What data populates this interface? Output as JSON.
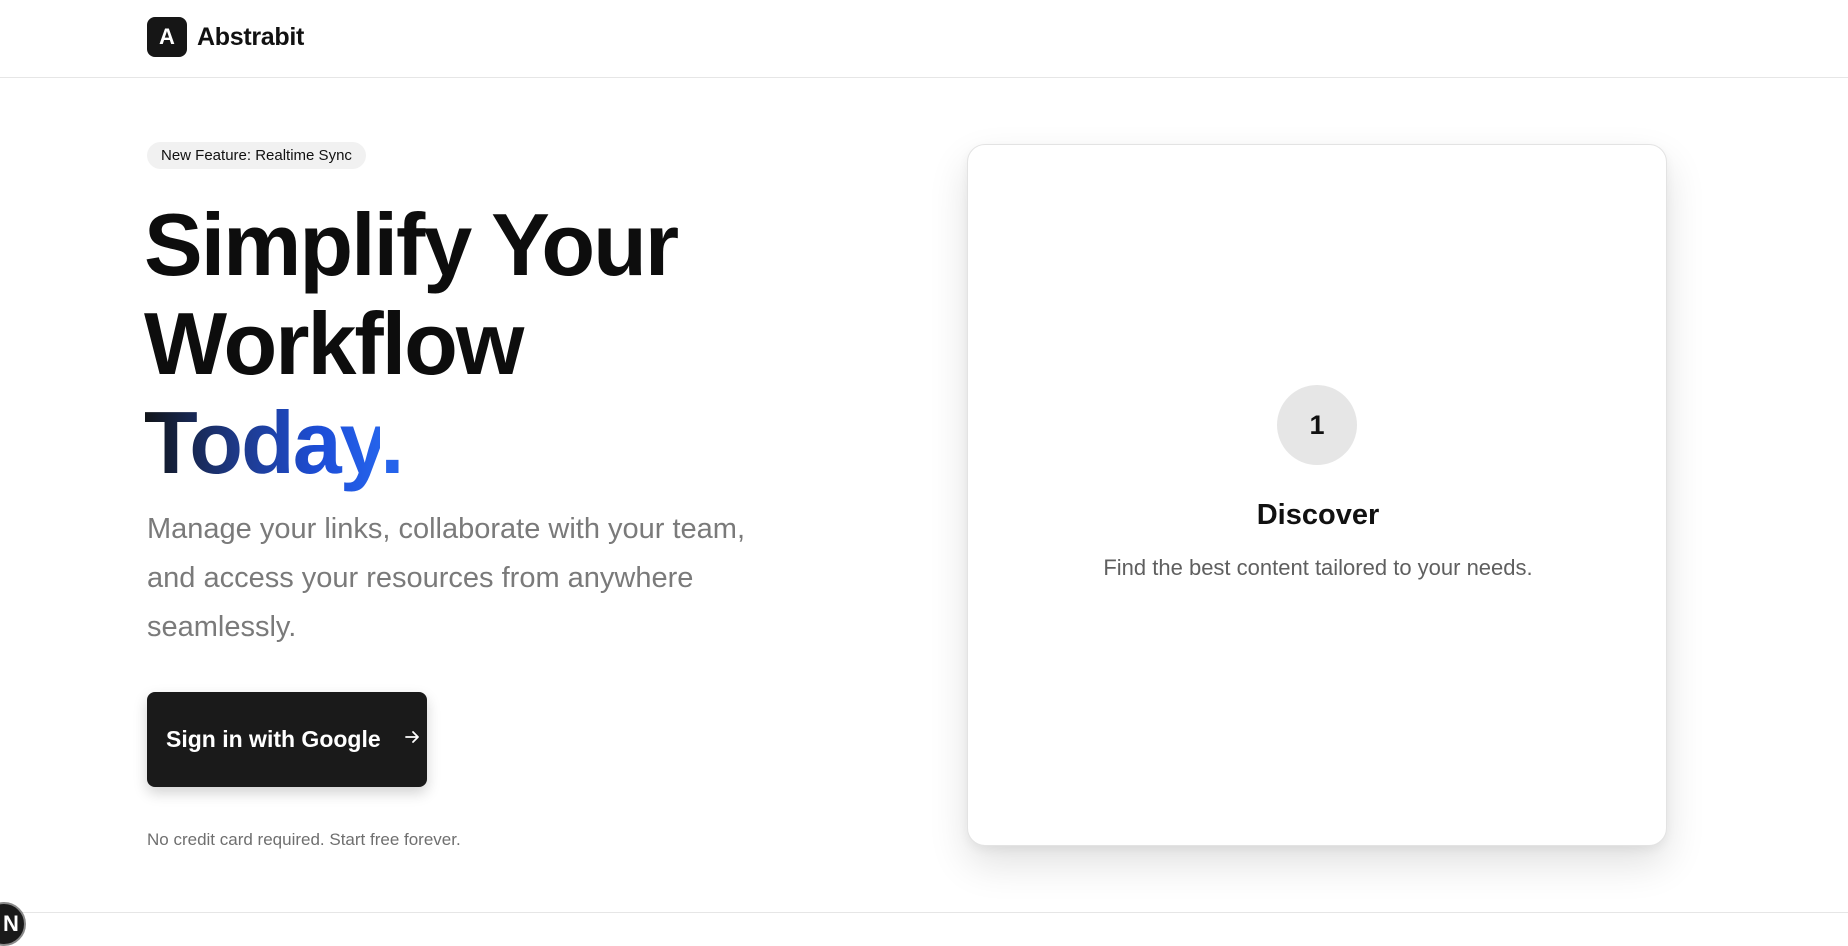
{
  "header": {
    "logo_letter": "A",
    "brand_name": "Abstrabit"
  },
  "hero": {
    "badge": "New Feature: Realtime Sync",
    "headline_line1": "Simplify Your",
    "headline_line2": "Workflow",
    "headline_line3": "Today",
    "headline_punct": ".",
    "subtitle": "Manage your links, collaborate with your team, and access your resources from anywhere seamlessly.",
    "cta_label": "Sign in with Google",
    "cta_icon": "arrow-right-icon",
    "note": "No credit card required. Start free forever."
  },
  "card": {
    "step_number": "1",
    "title": "Discover",
    "description": "Find the best content tailored to your needs."
  },
  "dev_badge": {
    "letter": "N"
  },
  "colors": {
    "primary_dark": "#1a1a1a",
    "accent_blue": "#2563eb",
    "muted_text": "#7a7a7a"
  }
}
